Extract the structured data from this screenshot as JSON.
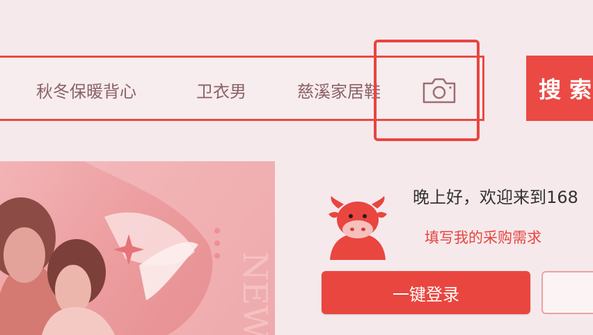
{
  "search": {
    "suggestions": [
      "秋冬保暖背心",
      "卫衣男",
      "慈溪家居鞋"
    ],
    "button_label": "搜索"
  },
  "icons": {
    "camera": "camera-icon",
    "mascot": "cow-mascot-icon"
  },
  "user_panel": {
    "greeting": "晚上好，欢迎来到168",
    "purchase_link": "填写我的采购需求",
    "login_label": "一键登录",
    "secondary_label": ""
  },
  "colors": {
    "accent": "#ea4a43",
    "background": "#f6e9ec",
    "chip_text": "#8b6265"
  }
}
